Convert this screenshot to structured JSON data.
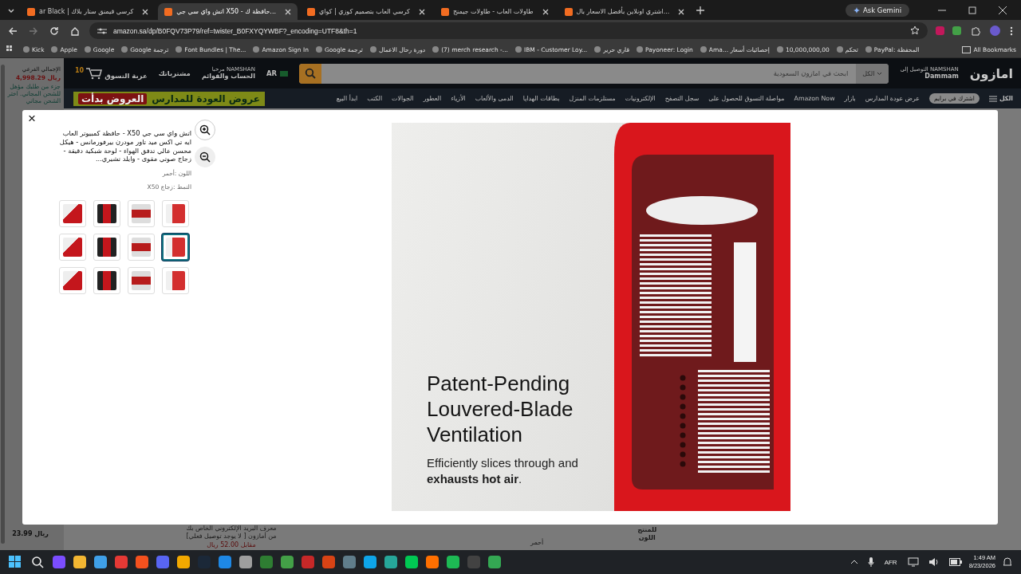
{
  "browser": {
    "tabs": [
      {
        "label": "اشتري اونلاين بأفضل الاسعار بال...",
        "selected": false
      },
      {
        "label": "طاولات العاب - طاولات جيمنج",
        "selected": false
      },
      {
        "label": "كرسي العاب بتصميم كوزي | كواي",
        "selected": false
      },
      {
        "label": "اتش واي سي جي X50 - حافظة ك...",
        "selected": true
      },
      {
        "label": "ar Black | كرسي قيمنق ستار بلاك",
        "selected": false
      }
    ],
    "ask_button": "Ask Gemini",
    "url": "amazon.sa/dp/B0FQV73P79/ref=twister_B0FXYQYWBF?_encoding=UTF8&th=1",
    "bookmarks": [
      "PayPal: المحفظة",
      "تحكم",
      "10,000,000,00",
      "Ama... إحصائيات أسعار",
      "Payoneer: Login",
      "قاري حرير",
      "IBM - Customer Loy...",
      "(7) merch research -...",
      "دورة رحال الاعمال",
      "Google ترجمة",
      "Amazon Sign In",
      "Font Bundles | The...",
      "Google ترجمة",
      "Google",
      "Apple",
      "Kick"
    ],
    "all_bookmarks": "All Bookmarks"
  },
  "cart_panel": {
    "label": "الإجمالي الفرعي",
    "total": "4,998.29 ريال",
    "note": "جزء من طلبك مؤهل للشحن المجاني. اختر الشحن مجاني"
  },
  "header": {
    "cart_count": "10",
    "cart": "عربة التسوق",
    "orders": "مشترياتك",
    "greeting": "مرحبا NAMSHAN",
    "account": "الحساب والقوائم",
    "language": "AR",
    "search_placeholder": "ابحث في امازون السعودية",
    "category": "الكل",
    "deliver_to": "التوصيل إلى NAMSHAN",
    "city": "Dammam",
    "logo": "امازون"
  },
  "nav": {
    "banner": "عروض العودة للمدارس",
    "banner_badge": "العروض بدأت",
    "menu": "الكل",
    "prime": "اشترك في برايم",
    "items": [
      "عرض عودة المدارس",
      "بازار",
      "Amazon Now",
      "مواصلة التسوق للحصول على",
      "سجل التصفح",
      "الإلكترونيات",
      "مستلزمات المنزل",
      "بطاقات الهدايا",
      "الدمى والألعاب",
      "الأزياء",
      "العطور",
      "الجوالات",
      "الكتب",
      "ابدأ البيع"
    ]
  },
  "modal": {
    "close": "×",
    "title": "اتش واي سي جي X50 - حافظة كمبيوتر العاب ايه تي اكس ميد تاور مودرن بيرفورمانس - هيكل محسن عالي تدفق الهواء - لوحة شبكية دقيقة - زجاج صوتي مقوى - وايلد تشيري...",
    "color_option": "اللون :أحمر",
    "style_option": "النمط :زجاج X50",
    "thumbnails": [
      {
        "selected": false
      },
      {
        "selected": false
      },
      {
        "selected": false
      },
      {
        "selected": false
      },
      {
        "selected": false
      },
      {
        "selected": false
      },
      {
        "selected": false
      },
      {
        "selected": true
      },
      {
        "selected": false
      },
      {
        "selected": false
      },
      {
        "selected": false
      },
      {
        "selected": false
      }
    ],
    "image": {
      "headline": "Patent-Pending Louvered-Blade Ventilation",
      "subtitle": "Efficiently slices through and **exhausts hot air**."
    }
  },
  "background": {
    "price": "23.99 ريال",
    "email_note": "معرف البريد الإلكتروني الخاص بك من أمازون [ لا يوجد توصيل فعلي]",
    "email_price": "مقابل 52.00 ريال",
    "product_label": "للمنتج",
    "color_label": "اللون",
    "color_value": "أحمر"
  },
  "taskbar": {
    "apps": [
      {
        "color": "#7b4dff"
      },
      {
        "color": "#f2b632"
      },
      {
        "color": "#3fa0e8"
      },
      {
        "color": "#e53935"
      },
      {
        "color": "#f4511e"
      },
      {
        "color": "#5865f2"
      },
      {
        "color": "#f2a900"
      },
      {
        "color": "#1b2838"
      },
      {
        "color": "#1e88e5"
      },
      {
        "color": "#9e9e9e"
      },
      {
        "color": "#2e7d32"
      },
      {
        "color": "#43a047"
      },
      {
        "color": "#c62828"
      },
      {
        "color": "#d84315"
      },
      {
        "color": "#607d8b"
      },
      {
        "color": "#0ea5e9"
      },
      {
        "color": "#26a69a"
      },
      {
        "color": "#00c853"
      },
      {
        "color": "#ff6f00"
      },
      {
        "color": "#1db954"
      },
      {
        "color": "#424242"
      },
      {
        "color": "#34a853"
      }
    ],
    "language": "AFR",
    "time": "1:49 AM",
    "date": "8/23/2026"
  }
}
